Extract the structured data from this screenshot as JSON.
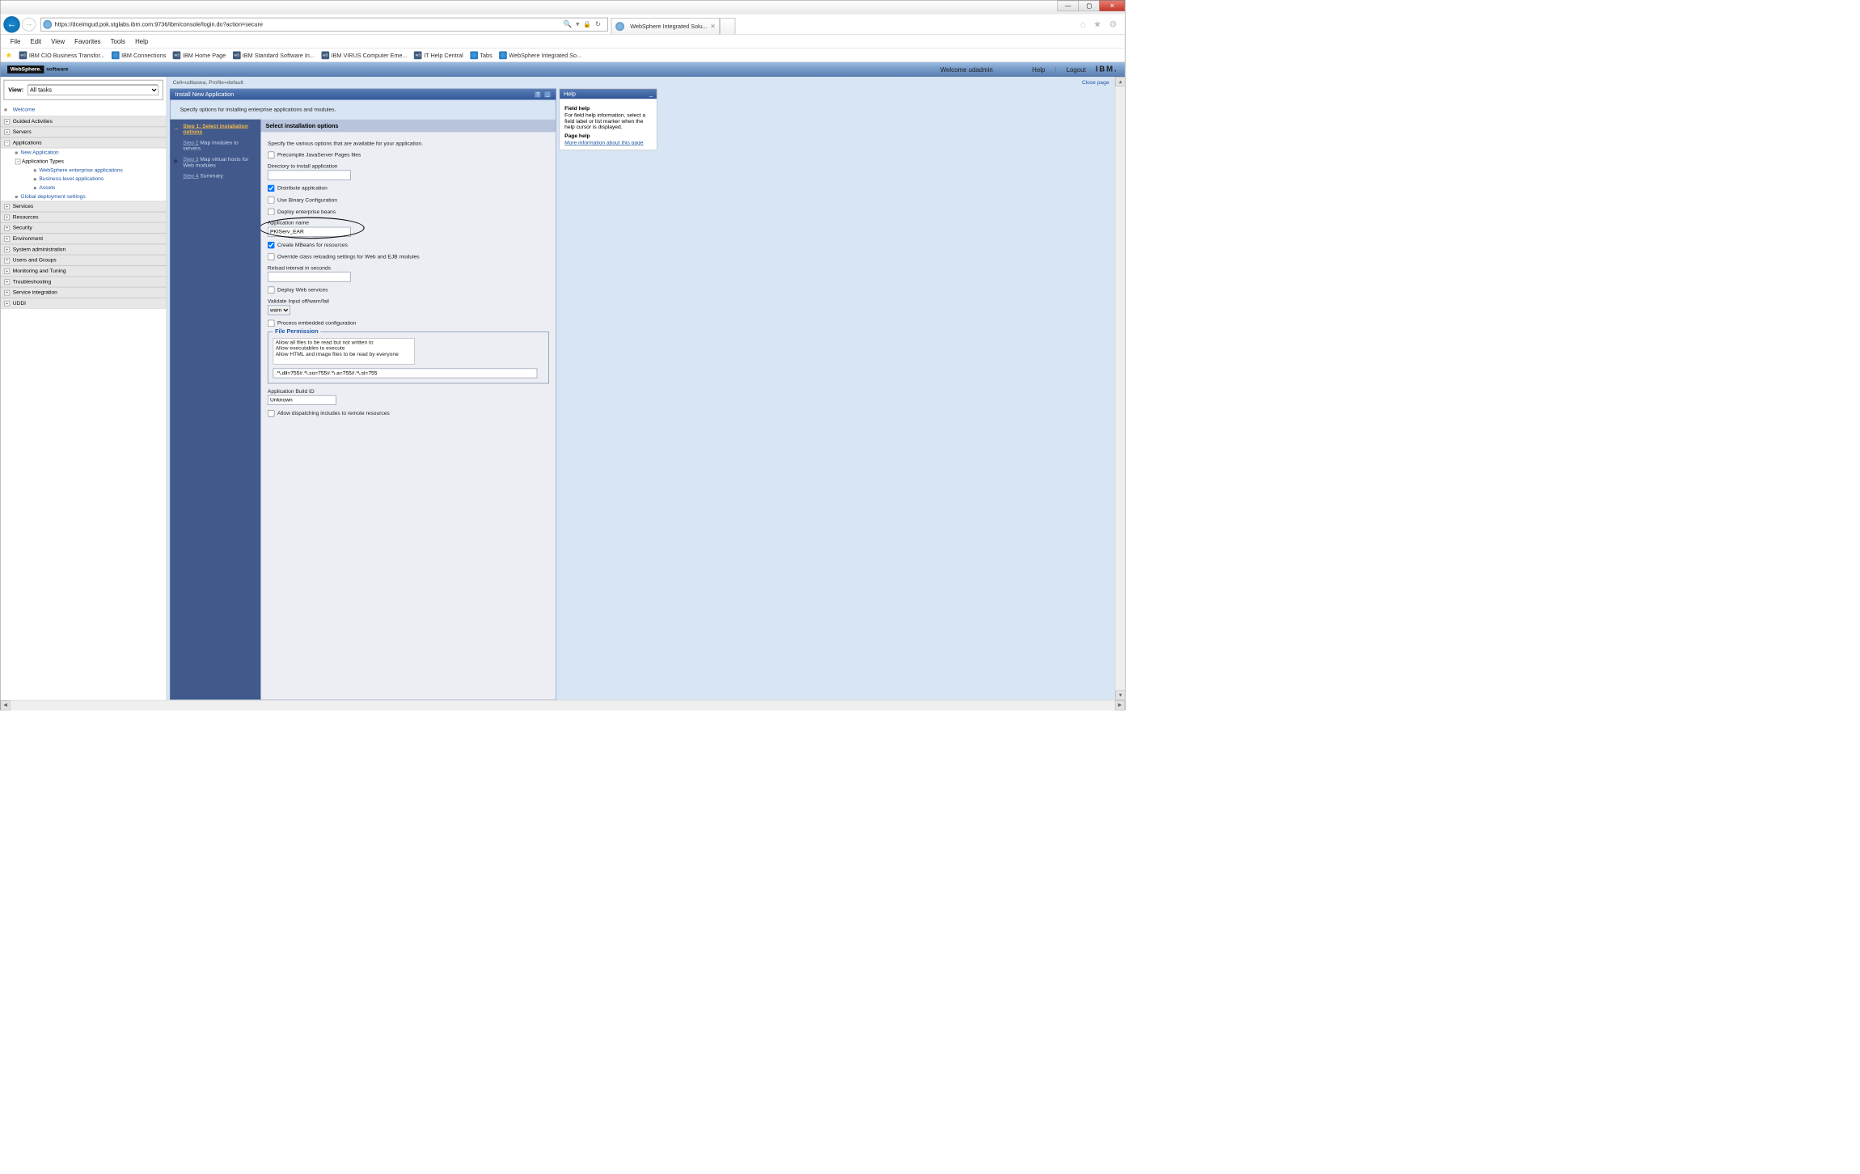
{
  "browser": {
    "url": "https://dceimgud.pok.stglabs.ibm.com:9736/ibm/console/login.do?action=secure",
    "tab_title": "WebSphere Integrated Solu...",
    "search_icon_title": "Search",
    "menus": [
      "File",
      "Edit",
      "View",
      "Favorites",
      "Tools",
      "Help"
    ],
    "favorites": [
      {
        "label": "IBM CIO Business Transfor...",
        "icon": "w3"
      },
      {
        "label": "IBM Connections",
        "icon": "ie"
      },
      {
        "label": "IBM Home Page",
        "icon": "w3"
      },
      {
        "label": "IBM Standard Software In...",
        "icon": "w3"
      },
      {
        "label": "IBM VIRUS Computer Eme...",
        "icon": "w3"
      },
      {
        "label": "IT Help Central",
        "icon": "w3"
      },
      {
        "label": "Tabs",
        "icon": "ie"
      },
      {
        "label": "WebSphere Integrated So...",
        "icon": "ie"
      }
    ]
  },
  "header": {
    "logo_dark": "WebSphere.",
    "logo_light": "software",
    "welcome": "Welcome udadmin",
    "help": "Help",
    "logout": "Logout",
    "ibm": "IBM."
  },
  "left": {
    "view_label": "View:",
    "view_value": "All tasks",
    "welcome": "Welcome",
    "items": [
      {
        "label": "Guided Activities",
        "exp": "+"
      },
      {
        "label": "Servers",
        "exp": "+"
      },
      {
        "label": "Applications",
        "exp": "−",
        "children": [
          {
            "label": "New Application"
          },
          {
            "label": "Application Types",
            "exp": "−",
            "children": [
              {
                "label": "WebSphere enterprise applications"
              },
              {
                "label": "Business-level applications"
              },
              {
                "label": "Assets"
              }
            ]
          },
          {
            "label": "Global deployment settings"
          }
        ]
      },
      {
        "label": "Services",
        "exp": "+"
      },
      {
        "label": "Resources",
        "exp": "+"
      },
      {
        "label": "Security",
        "exp": "+"
      },
      {
        "label": "Environment",
        "exp": "+"
      },
      {
        "label": "System administration",
        "exp": "+"
      },
      {
        "label": "Users and Groups",
        "exp": "+"
      },
      {
        "label": "Monitoring and Tuning",
        "exp": "+"
      },
      {
        "label": "Troubleshooting",
        "exp": "+"
      },
      {
        "label": "Service integration",
        "exp": "+"
      },
      {
        "label": "UDDI",
        "exp": "+"
      }
    ]
  },
  "main": {
    "crumb": "Cell=udbasea, Profile=default",
    "close_page": "Close page",
    "wizard_title": "Install New Application",
    "intro": "Specify options for installing enterprise applications and modules.",
    "steps": [
      {
        "title": "Step 1: Select installation options",
        "active": true
      },
      {
        "title": "Step 2",
        "sub": "Map modules to servers"
      },
      {
        "title": "Step 3",
        "sub": "Map virtual hosts for Web modules"
      },
      {
        "title": "Step 4",
        "sub": "Summary"
      }
    ],
    "form": {
      "heading": "Select installation options",
      "desc": "Specify the various options that are available for your application.",
      "precompile": "Precompile JavaServer Pages files",
      "dir_label": "Directory to install application",
      "dir_value": "",
      "distribute": "Distribute application",
      "use_binary": "Use Binary Configuration",
      "deploy_ejb": "Deploy enterprise beans",
      "app_name_label": "Application name",
      "app_name_value": "PKIServ_EAR",
      "create_mbeans": "Create MBeans for resources",
      "override_reload": "Override class reloading settings for Web and EJB modules",
      "reload_label": "Reload interval in seconds",
      "reload_value": "",
      "deploy_ws": "Deploy Web services",
      "validate_label": "Validate Input off/warn/fail",
      "validate_value": "warn",
      "process_embedded": "Process embedded configuration",
      "file_perm_legend": "File Permission",
      "perm_options": [
        "Allow all files to be read but not written to",
        "Allow executables to execute",
        "Allow HTML and image files to be read by everyone"
      ],
      "perm_value": ".*\\.dll=755#.*\\.so=755#.*\\.a=755#.*\\.sl=755",
      "build_label": "Application Build ID",
      "build_value": "Unknown",
      "allow_dispatch": "Allow dispatching includes to remote resources"
    }
  },
  "help": {
    "title": "Help",
    "field_h": "Field help",
    "field_body": "For field help information, select a field label or list marker when the help cursor is displayed.",
    "page_h": "Page help",
    "page_link": "More information about this page"
  }
}
